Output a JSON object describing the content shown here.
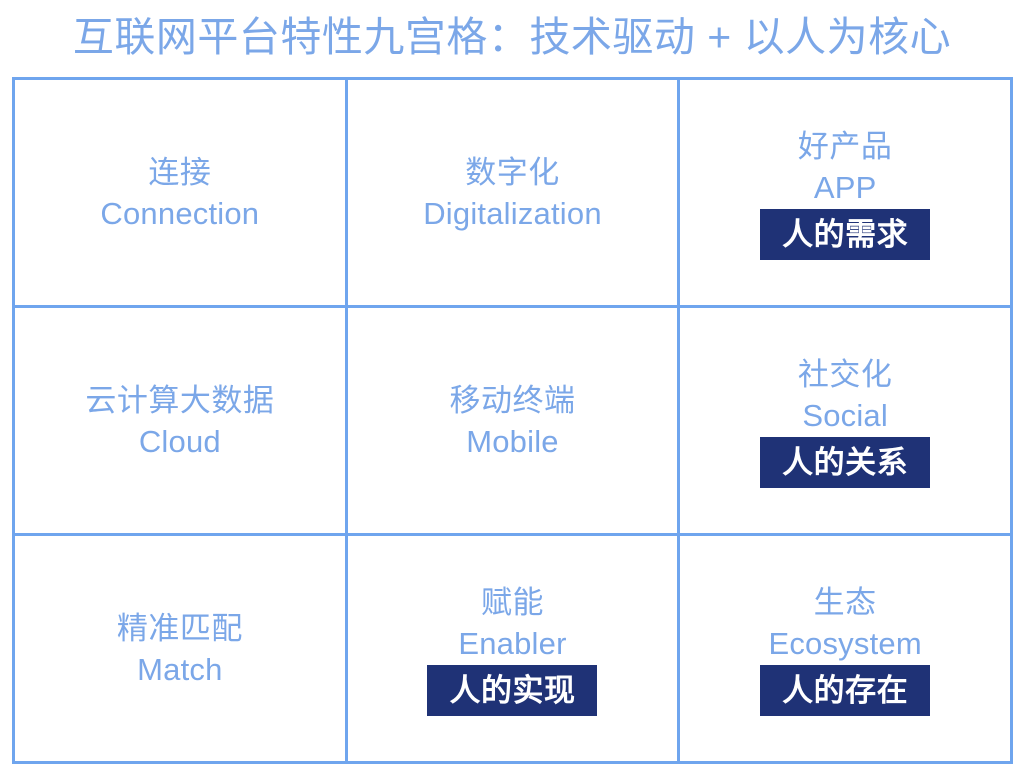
{
  "slide": {
    "title": "互联网平台特性九宫格：技术驱动 + 以人为核心",
    "colors": {
      "accent_blue": "#7BA7E8",
      "grid_line": "#6FA5EE",
      "badge_navy": "#1F3276",
      "badge_text": "#FFFFFF",
      "background": "#FFFFFF"
    }
  },
  "grid": {
    "rows": 3,
    "columns": 3,
    "cells": [
      {
        "cn": "连接",
        "en": "Connection",
        "badge": ""
      },
      {
        "cn": "数字化",
        "en": "Digitalization",
        "badge": ""
      },
      {
        "cn": "好产品",
        "en": "APP",
        "badge": "人的需求"
      },
      {
        "cn": "云计算大数据",
        "en": "Cloud",
        "badge": ""
      },
      {
        "cn": "移动终端",
        "en": "Mobile",
        "badge": ""
      },
      {
        "cn": "社交化",
        "en": "Social",
        "badge": "人的关系"
      },
      {
        "cn": "精准匹配",
        "en": "Match",
        "badge": ""
      },
      {
        "cn": "赋能",
        "en": "Enabler",
        "badge": "人的实现"
      },
      {
        "cn": "生态",
        "en": "Ecosystem",
        "badge": "人的存在"
      }
    ]
  }
}
